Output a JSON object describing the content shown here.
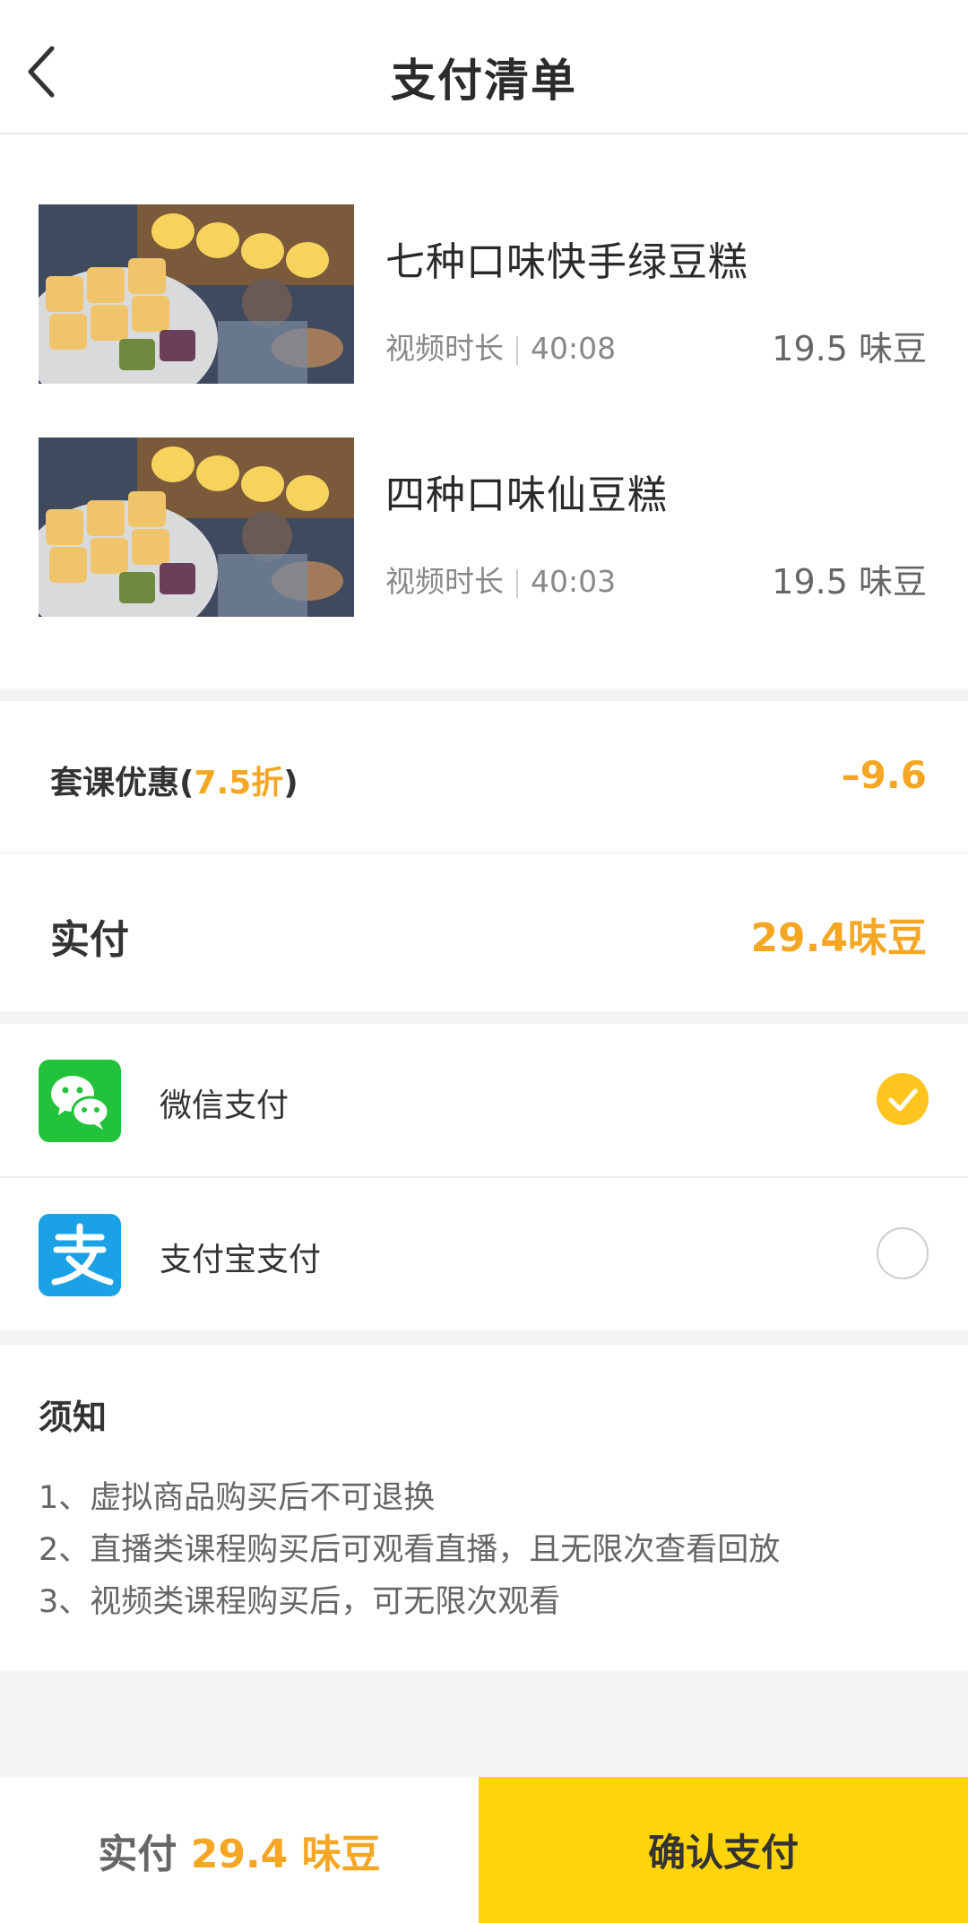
{
  "header": {
    "title": "支付清单"
  },
  "courses": [
    {
      "name": "七种口味快手绿豆糕",
      "meta_label": "视频时长",
      "duration": "40:08",
      "price": "19.5 味豆"
    },
    {
      "name": "四种口味仙豆糕",
      "meta_label": "视频时长",
      "duration": "40:03",
      "price": "19.5 味豆"
    }
  ],
  "discount": {
    "label_prefix": "套课优惠(",
    "label_rate": "7.5折",
    "label_suffix": ")",
    "value": "–9.6"
  },
  "paid": {
    "label": "实付",
    "value": "29.4味豆"
  },
  "payment_methods": [
    {
      "label": "微信支付",
      "icon": "wechat-icon",
      "selected": true
    },
    {
      "label": "支付宝支付",
      "icon": "alipay-icon",
      "selected": false
    }
  ],
  "notice": {
    "title": "须知",
    "lines": [
      "1、虚拟商品购买后不可退换",
      "2、直播类课程购买后可观看直播，且无限次查看回放",
      "3、视频类课程购买后，可无限次观看"
    ]
  },
  "bottom": {
    "total_label": "实付",
    "total_value": "29.4 味豆",
    "confirm_label": "确认支付"
  },
  "colors": {
    "accent": "#f5a623",
    "confirm_bg": "#ffd40b",
    "wechat": "#22c33a",
    "alipay": "#1aa1e6"
  }
}
